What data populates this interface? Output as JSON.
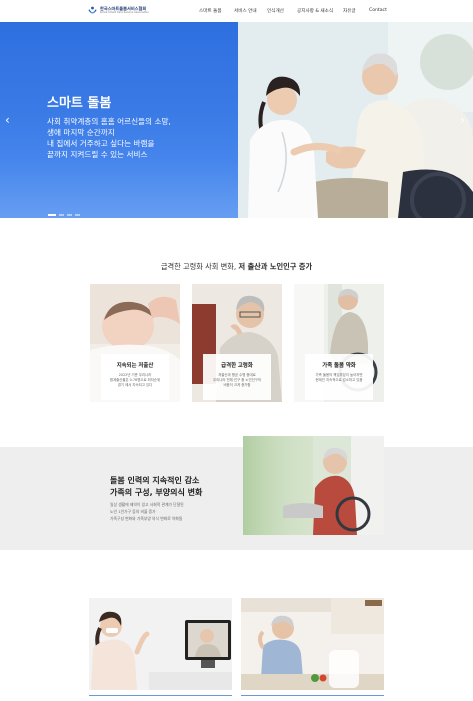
{
  "header": {
    "logo_text": "한국스마트돌봄서비스협회",
    "logo_subtext": "Korea Smart Care Service Association",
    "nav": [
      "스마트 돌봄",
      "서비스 안내",
      "인식개선",
      "공지사항 & 새소식",
      "자유글",
      "Contact"
    ]
  },
  "hero": {
    "title": "스마트 돌봄",
    "lines": [
      "사회 취약계층의 홈홈 어르신들의 소망,",
      "생애 마지막 순간까지",
      "내 집에서 거주하고 싶다는 바램을",
      "끝까지 지켜드릴 수 있는 서비스"
    ],
    "prev_icon": "chevron-left-icon",
    "next_icon": "chevron-right-icon",
    "slide_count": 4,
    "active_slide": 1
  },
  "section2": {
    "title_prefix": "급격한 고령화 사회 변화, ",
    "title_strong": "저 출산과 노인인구 증가",
    "cards": [
      {
        "heading": "지속되는 저출산",
        "desc": [
          "2022년 기준 우리나라",
          "합계출산율은 0.78명으로 최저순위",
          "경기 에서 지속되고 있다"
        ]
      },
      {
        "heading": "급격한 고령화",
        "desc": [
          "저출산과 평균 수명 증대로",
          "우리나라 전체 인구 중 노인인구의",
          "비중이 크게 증가함"
        ]
      },
      {
        "heading": "가족 돌봄 약화",
        "desc": [
          "가족 돌봄의 책임부담이 높아지면",
          "현재인 지속적으로 감소하고 있음"
        ]
      }
    ]
  },
  "section3": {
    "heading_lines": [
      "돌봄 인력의 지속적인 감소",
      "가족의 구성, 부양의식 변화"
    ],
    "desc_lines": [
      "일상 생활에 제약이 있고 사회적 관계가 단절된",
      "노인 1인가구 등의 비율 증가",
      "가족구성 변화와 가족부양 의식 변화로 약화됨"
    ]
  },
  "colors": {
    "hero_blue": "#3a7ae6",
    "navy": "#1f3f77",
    "section_gray": "#eeeeee",
    "accent_line": "#6a98d9"
  }
}
